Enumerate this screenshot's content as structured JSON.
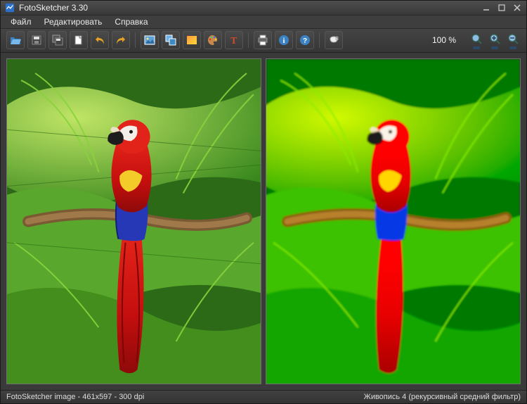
{
  "window": {
    "title": "FotoSketcher 3.30"
  },
  "menu": {
    "file": "Файл",
    "edit": "Редактировать",
    "help": "Справка"
  },
  "toolbar": {
    "open": "Open",
    "save": "Save",
    "save_as": "Save As",
    "new": "New",
    "undo": "Undo",
    "redo": "Redo",
    "source_image": "Source",
    "batch": "Batch",
    "post": "Post",
    "palette": "Palette",
    "text": "Text",
    "print": "Print",
    "info": "Info",
    "help_btn": "Help",
    "donate": "Donate"
  },
  "zoom": {
    "label": "100 %"
  },
  "status": {
    "left": "FotoSketcher image - 461x597 - 300 dpi",
    "right": "Живопись 4 (рекурсивный средний фильтр)"
  }
}
